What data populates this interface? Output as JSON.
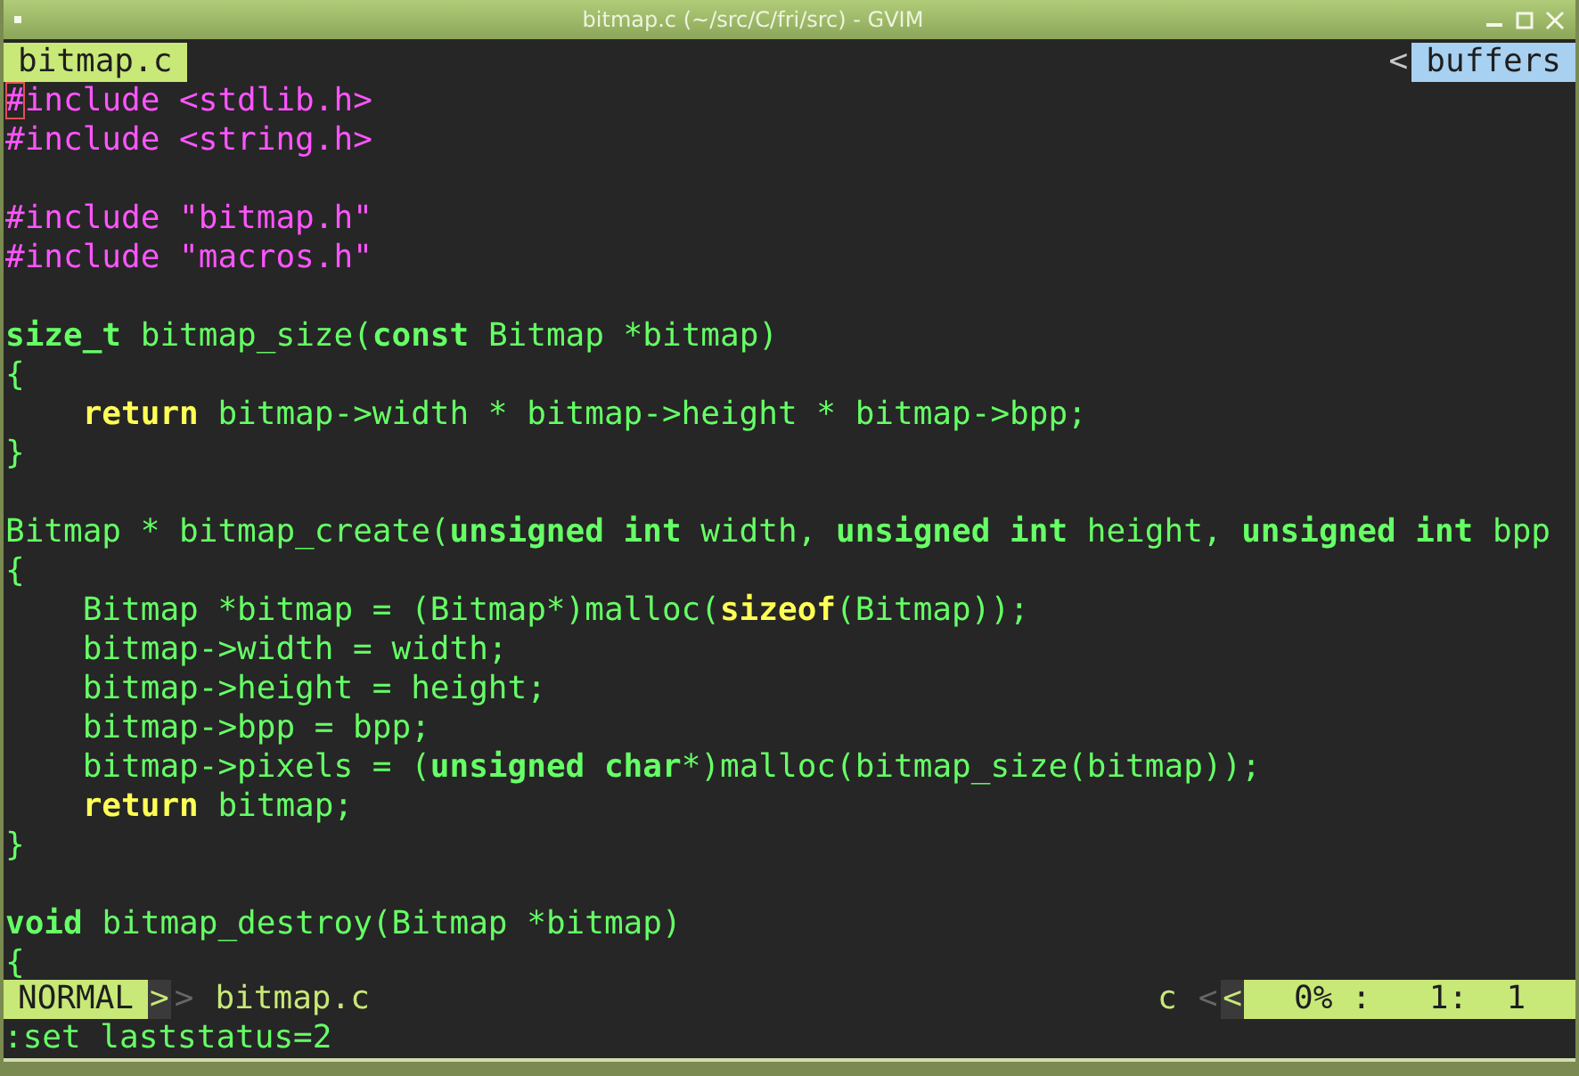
{
  "window": {
    "title": "bitmap.c (~/src/C/fri/src) - GVIM"
  },
  "tabline": {
    "tabs": [
      {
        "label": "bitmap.c",
        "selected": true
      }
    ],
    "separator": "<",
    "buffers_label": "buffers"
  },
  "lines": [
    {
      "kind": "code",
      "indented": false,
      "tokens": [
        {
          "text": "#",
          "kind": "cursor"
        },
        {
          "text": "include <stdlib.h>",
          "kind": "preproc"
        }
      ]
    },
    {
      "kind": "code",
      "indented": false,
      "tokens": [
        {
          "text": "#include <string.h>",
          "kind": "preproc"
        }
      ]
    },
    {
      "kind": "blank"
    },
    {
      "kind": "code",
      "indented": false,
      "tokens": [
        {
          "text": "#include \"bitmap.h\"",
          "kind": "preproc"
        }
      ]
    },
    {
      "kind": "code",
      "indented": false,
      "tokens": [
        {
          "text": "#include \"macros.h\"",
          "kind": "preproc"
        }
      ]
    },
    {
      "kind": "blank"
    },
    {
      "kind": "code",
      "indented": false,
      "tokens": [
        {
          "text": "size_t",
          "kind": "type"
        },
        {
          "text": " bitmap_size(",
          "kind": "plain"
        },
        {
          "text": "const",
          "kind": "type"
        },
        {
          "text": " Bitmap *bitmap)",
          "kind": "plain"
        }
      ]
    },
    {
      "kind": "code",
      "indented": false,
      "tokens": [
        {
          "text": "{",
          "kind": "plain"
        }
      ]
    },
    {
      "kind": "code",
      "indented": true,
      "tokens": [
        {
          "text": "return",
          "kind": "statement"
        },
        {
          "text": " bitmap->width * bitmap->height * bitmap->bpp;",
          "kind": "plain"
        }
      ]
    },
    {
      "kind": "code",
      "indented": false,
      "tokens": [
        {
          "text": "}",
          "kind": "plain"
        }
      ]
    },
    {
      "kind": "blank"
    },
    {
      "kind": "code",
      "indented": false,
      "tokens": [
        {
          "text": "Bitmap * bitmap_create(",
          "kind": "plain"
        },
        {
          "text": "unsigned int",
          "kind": "type"
        },
        {
          "text": " width, ",
          "kind": "plain"
        },
        {
          "text": "unsigned int",
          "kind": "type"
        },
        {
          "text": " height, ",
          "kind": "plain"
        },
        {
          "text": "unsigned int",
          "kind": "type"
        },
        {
          "text": " bpp",
          "kind": "plain"
        }
      ]
    },
    {
      "kind": "code",
      "indented": false,
      "tokens": [
        {
          "text": "{",
          "kind": "plain"
        }
      ]
    },
    {
      "kind": "code",
      "indented": true,
      "tokens": [
        {
          "text": "Bitmap *bitmap = (Bitmap*)malloc(",
          "kind": "plain"
        },
        {
          "text": "sizeof",
          "kind": "statement"
        },
        {
          "text": "(Bitmap));",
          "kind": "plain"
        }
      ]
    },
    {
      "kind": "code",
      "indented": true,
      "tokens": [
        {
          "text": "bitmap->width = width;",
          "kind": "plain"
        }
      ]
    },
    {
      "kind": "code",
      "indented": true,
      "tokens": [
        {
          "text": "bitmap->height = height;",
          "kind": "plain"
        }
      ]
    },
    {
      "kind": "code",
      "indented": true,
      "tokens": [
        {
          "text": "bitmap->bpp = bpp;",
          "kind": "plain"
        }
      ]
    },
    {
      "kind": "code",
      "indented": true,
      "tokens": [
        {
          "text": "bitmap->pixels = (",
          "kind": "plain"
        },
        {
          "text": "unsigned char",
          "kind": "type"
        },
        {
          "text": "*)malloc(bitmap_size(bitmap));",
          "kind": "plain"
        }
      ]
    },
    {
      "kind": "code",
      "indented": true,
      "tokens": [
        {
          "text": "return",
          "kind": "statement"
        },
        {
          "text": " bitmap;",
          "kind": "plain"
        }
      ]
    },
    {
      "kind": "code",
      "indented": false,
      "tokens": [
        {
          "text": "}",
          "kind": "plain"
        }
      ]
    },
    {
      "kind": "blank"
    },
    {
      "kind": "code",
      "indented": false,
      "tokens": [
        {
          "text": "void",
          "kind": "type"
        },
        {
          "text": " bitmap_destroy(Bitmap *bitmap)",
          "kind": "plain"
        }
      ]
    },
    {
      "kind": "code",
      "indented": false,
      "tokens": [
        {
          "text": "{",
          "kind": "plain"
        }
      ]
    }
  ],
  "statusline": {
    "mode": "NORMAL",
    "separators": [
      ">",
      ">"
    ],
    "filename": "bitmap.c",
    "filetype": "c",
    "right_separators": [
      "<",
      "<"
    ],
    "position": "0% :   1:  1"
  },
  "command_line": ":set laststatus=2"
}
